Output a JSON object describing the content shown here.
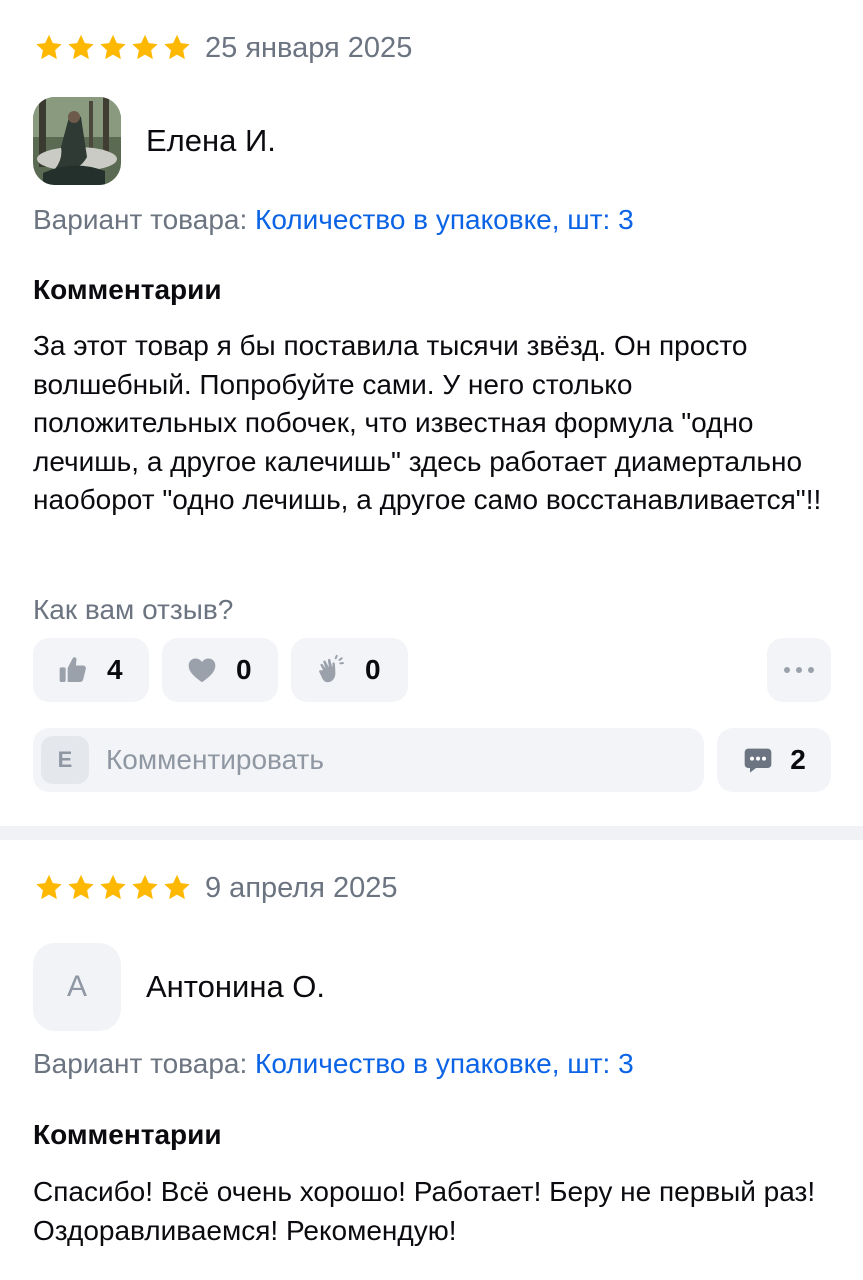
{
  "colors": {
    "star": "#ffb800",
    "link": "#0b63e5",
    "muted": "#6b7480",
    "chip_bg": "#f3f4f7",
    "icon_gray": "#9aa1ab"
  },
  "reviews": [
    {
      "date": "25 января 2025",
      "stars": 5,
      "author": "Елена И.",
      "avatar_type": "photo",
      "variant_label": "Вариант товара:",
      "variant_value": "Количество в упаковке, шт: 3",
      "comments_heading": "Комментарии",
      "text": "За этот товар я бы поставила тысячи звёзд. Он просто волшебный. Попробуйте сами. У него столько положительных побочек, что известная формула \"одно лечишь, а другое калечишь\" здесь работает диамертально наоборот \"одно лечишь, а другое само восстанавливается\"!!",
      "feedback_question": "Как вам отзыв?",
      "reactions": {
        "like": {
          "icon": "thumbs-up-icon",
          "count": "4"
        },
        "heart": {
          "icon": "heart-icon",
          "count": "0"
        },
        "clap": {
          "icon": "clap-icon",
          "count": "0"
        }
      },
      "more_icon": "more-horizontal-icon",
      "comment_input": {
        "user_initial": "Е",
        "placeholder": "Комментировать"
      },
      "comments_count": {
        "icon": "chat-bubble-icon",
        "count": "2"
      }
    },
    {
      "date": "9 апреля 2025",
      "stars": 5,
      "author": "Антонина О.",
      "avatar_type": "letter",
      "avatar_letter": "А",
      "variant_label": "Вариант товара:",
      "variant_value": "Количество в упаковке, шт: 3",
      "comments_heading": "Комментарии",
      "text": "Спасибо! Всё очень хорошо! Работает! Беру не первый раз! Оздоравливаемся! Рекомендую!"
    }
  ]
}
